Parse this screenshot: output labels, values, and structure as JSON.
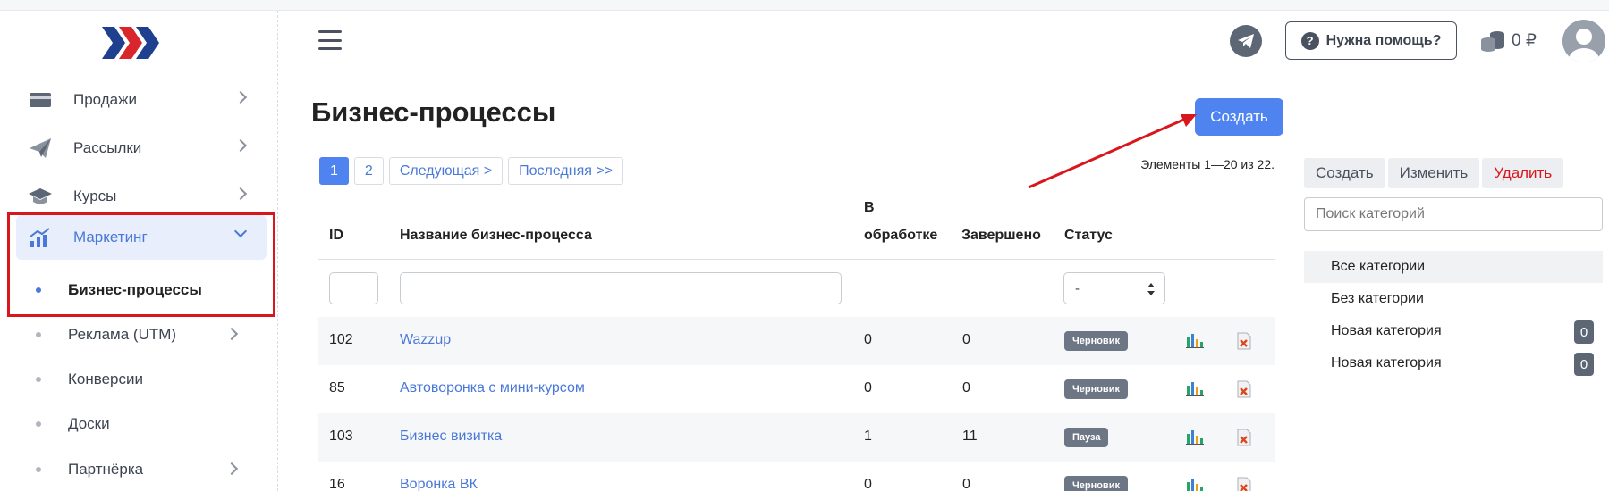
{
  "sidebar": {
    "items": [
      {
        "label": "Продажи",
        "icon": "wallet-icon"
      },
      {
        "label": "Рассылки",
        "icon": "paper-plane-icon"
      },
      {
        "label": "Курсы",
        "icon": "graduation-cap-icon"
      },
      {
        "label": "Маркетинг",
        "icon": "chart-up-icon"
      }
    ],
    "subitems": [
      {
        "label": "Бизнес-процессы"
      },
      {
        "label": "Реклама (UTM)"
      },
      {
        "label": "Конверсии"
      },
      {
        "label": "Доски"
      },
      {
        "label": "Партнёрка"
      }
    ]
  },
  "header": {
    "help_label": "Нужна помощь?",
    "balance": "0 ₽"
  },
  "main": {
    "title": "Бизнес-процессы",
    "create_label": "Создать",
    "pager": [
      "1",
      "2",
      "Следующая >",
      "Последняя >>"
    ],
    "elements_info": "Элементы 1—20 из 22.",
    "columns": {
      "id": "ID",
      "name": "Название бизнес-процесса",
      "processing_1": "В",
      "processing_2": "обработке",
      "done": "Завершено",
      "status": "Статус"
    },
    "status_filter": "-",
    "rows": [
      {
        "id": "102",
        "name": "Wazzup",
        "processing": "0",
        "done": "0",
        "status": "Черновик"
      },
      {
        "id": "85",
        "name": "Автоворонка с мини-курсом",
        "processing": "0",
        "done": "0",
        "status": "Черновик"
      },
      {
        "id": "103",
        "name": "Бизнес визитка",
        "processing": "1",
        "done": "11",
        "status": "Пауза"
      },
      {
        "id": "16",
        "name": "Воронка ВК",
        "processing": "0",
        "done": "0",
        "status": "Черновик"
      }
    ]
  },
  "categories": {
    "buttons": {
      "create": "Создать",
      "edit": "Изменить",
      "delete": "Удалить"
    },
    "search_placeholder": "Поиск категорий",
    "items": [
      {
        "label": "Все категории",
        "count": ""
      },
      {
        "label": "Без категории",
        "count": ""
      },
      {
        "label": "Новая категория",
        "count": "0"
      },
      {
        "label": "Новая категория",
        "count": "0"
      }
    ]
  },
  "colors": {
    "accent": "#4e83f0",
    "link": "#4a78d8",
    "danger": "#d9161c",
    "badge": "#6c7685"
  }
}
